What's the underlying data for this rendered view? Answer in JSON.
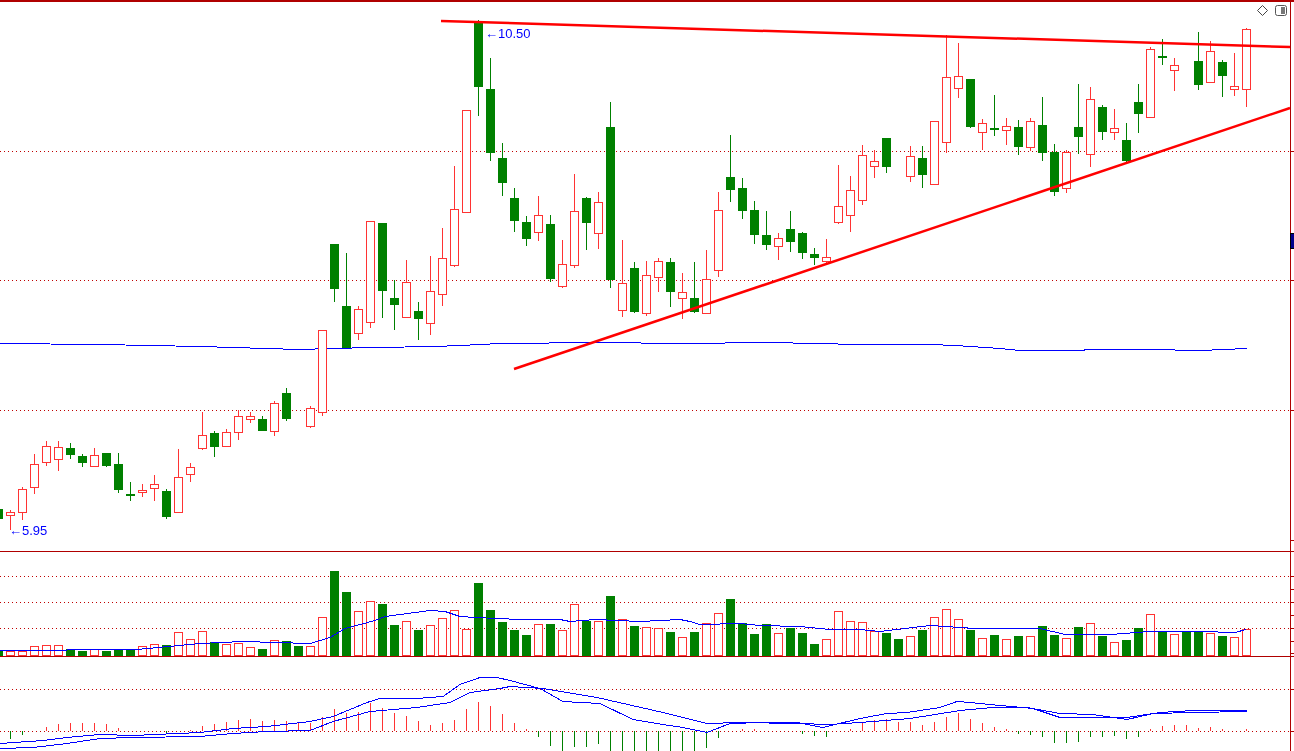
{
  "price_panel": {
    "highest_price_label": "←10.50",
    "lowest_price_label": "←5.95"
  }
}
